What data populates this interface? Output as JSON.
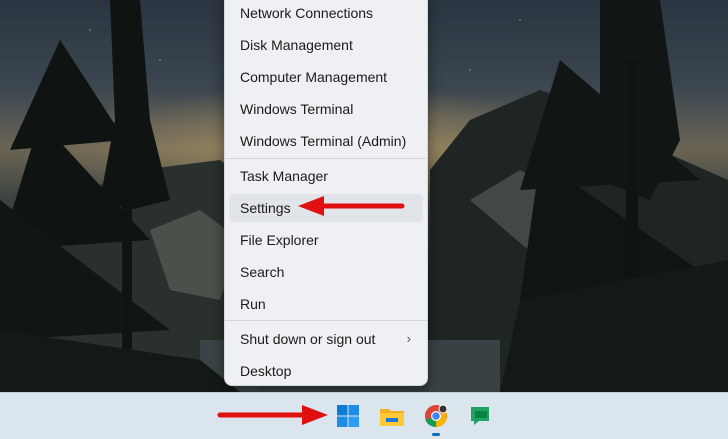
{
  "context_menu": {
    "items": [
      {
        "label": "Network Connections"
      },
      {
        "label": "Disk Management"
      },
      {
        "label": "Computer Management"
      },
      {
        "label": "Windows Terminal"
      },
      {
        "label": "Windows Terminal (Admin)"
      },
      {
        "label": "Task Manager"
      },
      {
        "label": "Settings"
      },
      {
        "label": "File Explorer"
      },
      {
        "label": "Search"
      },
      {
        "label": "Run"
      },
      {
        "label": "Shut down or sign out"
      },
      {
        "label": "Desktop"
      }
    ],
    "highlighted_item": "Settings"
  },
  "taskbar": {
    "apps": [
      {
        "icon": "windows-start-icon"
      },
      {
        "icon": "file-explorer-icon"
      },
      {
        "icon": "chrome-icon"
      },
      {
        "icon": "google-chat-icon"
      }
    ]
  },
  "annotations": {
    "arrow_color": "#e01010"
  }
}
